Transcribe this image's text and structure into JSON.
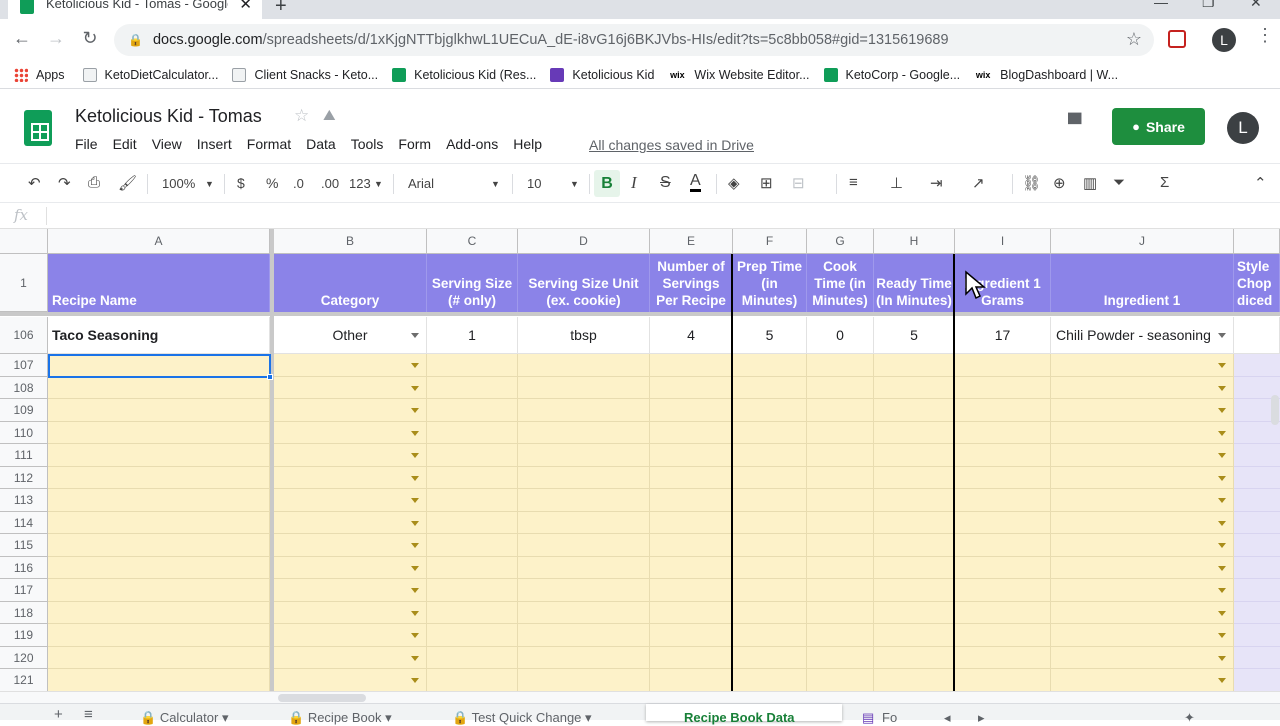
{
  "browser": {
    "tab_title": "Ketolicious Kid - Tomas - Google",
    "tab_close": "✕",
    "new_tab": "+",
    "url_host": "docs.google.com",
    "url_path": "/spreadsheets/d/1xKjgNTTbjglkhwL1UECuA_dE-i8vG16j6BKJVbs-HIs/edit?ts=5c8bb058#gid=1315619689",
    "avatar_letter": "L",
    "bookmarks": [
      {
        "label": "Apps",
        "icon": "apps-grid-icon",
        "color": "#ea4335"
      },
      {
        "label": "KetoDietCalculator...",
        "icon": "page-icon",
        "color": "#9aa0a6"
      },
      {
        "label": "Client Snacks - Keto...",
        "icon": "page-icon",
        "color": "#9aa0a6"
      },
      {
        "label": "Ketolicious Kid (Res...",
        "icon": "sheets-icon",
        "color": "#0f9d58"
      },
      {
        "label": "Ketolicious Kid",
        "icon": "forms-icon",
        "color": "#673ab7"
      },
      {
        "label": "Wix Website Editor...",
        "icon": "wix-icon",
        "color": "#000000"
      },
      {
        "label": "KetoCorp - Google...",
        "icon": "sheets-icon",
        "color": "#0f9d58"
      },
      {
        "label": "BlogDashboard | W...",
        "icon": "wix-icon",
        "color": "#000000"
      }
    ]
  },
  "doc": {
    "title": "Ketolicious Kid - Tomas",
    "menu": [
      "File",
      "Edit",
      "View",
      "Insert",
      "Format",
      "Data",
      "Tools",
      "Form",
      "Add-ons",
      "Help"
    ],
    "saved_message": "All changes saved in Drive",
    "share_label": "Share",
    "avatar_letter": "L"
  },
  "toolbar": {
    "zoom": "100%",
    "currency": "$",
    "percent": "%",
    "dec_decrease": ".0",
    "dec_increase": ".00",
    "more_formats": "123",
    "font": "Arial",
    "font_size": "10",
    "bold": "B",
    "italic": "I",
    "strike": "S",
    "text_color": "A"
  },
  "formula_bar": {
    "fx": "fx"
  },
  "columns": [
    {
      "letter": "A",
      "header": "Recipe Name"
    },
    {
      "letter": "B",
      "header": "Category"
    },
    {
      "letter": "C",
      "header": "Serving Size (# only)"
    },
    {
      "letter": "D",
      "header": "Serving Size Unit (ex. cookie)"
    },
    {
      "letter": "E",
      "header": "Number of Servings Per Recipe"
    },
    {
      "letter": "F",
      "header": "Prep Time (in Minutes)"
    },
    {
      "letter": "G",
      "header": "Cook Time (in Minutes)"
    },
    {
      "letter": "H",
      "header": "Ready Time (In Minutes)"
    },
    {
      "letter": "I",
      "header": "Ingredient 1 Grams"
    },
    {
      "letter": "J",
      "header": "Ingredient 1"
    },
    {
      "letter": "",
      "header": "Style Chop diced"
    }
  ],
  "header_row_number": "1",
  "data_row": {
    "number": "106",
    "values": [
      "Taco Seasoning",
      "Other",
      "1",
      "tbsp",
      "4",
      "5",
      "0",
      "5",
      "17",
      "Chili Powder - seasoning"
    ]
  },
  "empty_rows": [
    "107",
    "108",
    "109",
    "110",
    "111",
    "112",
    "113",
    "114",
    "115",
    "116",
    "117",
    "118",
    "119",
    "120",
    "121"
  ],
  "sheet_tabs": {
    "add": "+",
    "list": "≡",
    "tabs": [
      "Calculator",
      "Recipe Book",
      "Test Quick Change"
    ],
    "active": "Recipe Book Data",
    "partial": "Fo"
  },
  "colors": {
    "header_purple": "#8b83e8",
    "input_yellow": "#fdf2c9",
    "share_green": "#1e8e3e"
  }
}
